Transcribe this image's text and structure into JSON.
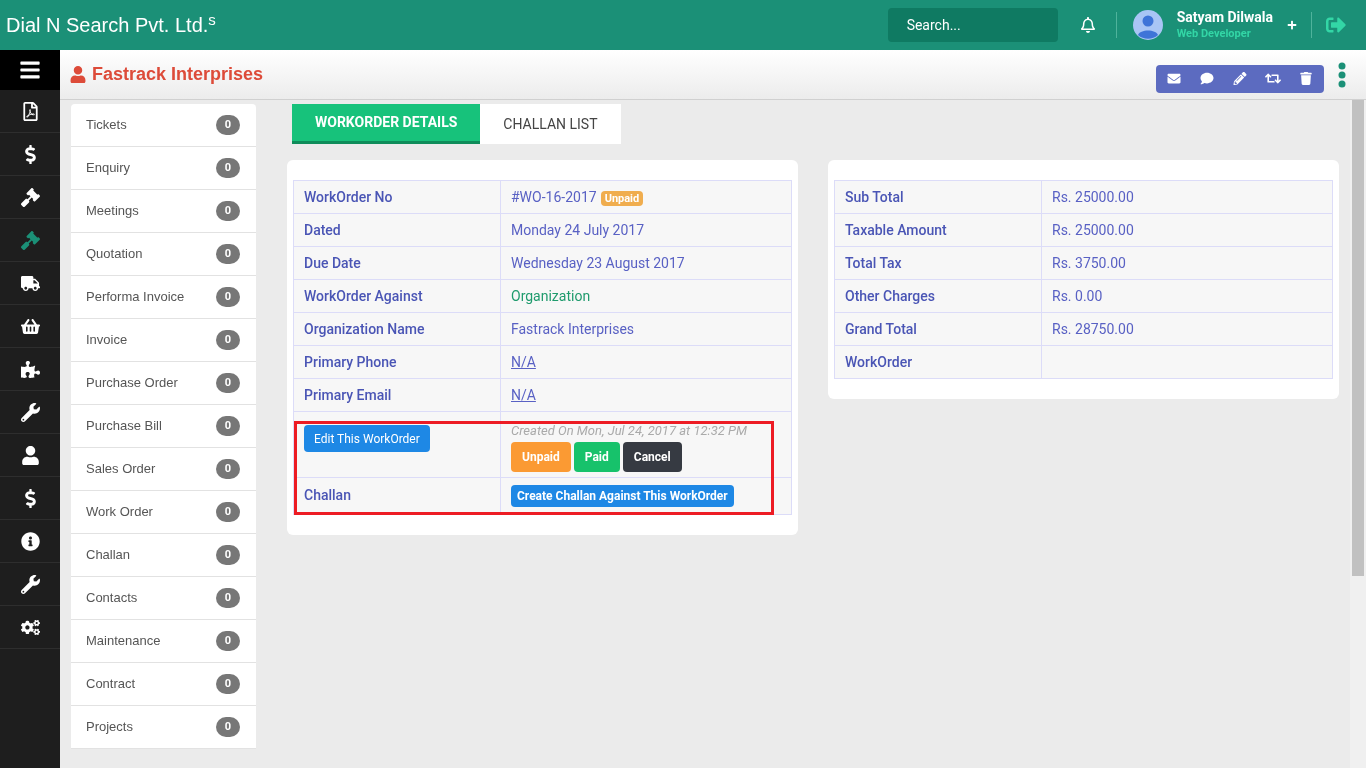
{
  "topbar": {
    "brand": "Dial N Search Pvt. Ltd.$^{s}$",
    "search": {
      "placeholder": "Search..."
    },
    "user": {
      "name": "Satyam Dilwala",
      "role": "Web Developer"
    }
  },
  "rail": [
    {
      "kind": "pdf",
      "selected": false
    },
    {
      "kind": "dollar",
      "selected": false
    },
    {
      "kind": "gavel",
      "selected": false
    },
    {
      "kind": "gavel",
      "selected": true
    },
    {
      "kind": "truck",
      "selected": false
    },
    {
      "kind": "basket",
      "selected": false
    },
    {
      "kind": "puzzle",
      "selected": false
    },
    {
      "kind": "wrench",
      "selected": false
    },
    {
      "kind": "user",
      "selected": false
    },
    {
      "kind": "dollar",
      "selected": false
    },
    {
      "kind": "info",
      "selected": false
    },
    {
      "kind": "wrench",
      "selected": false
    },
    {
      "kind": "cogs",
      "selected": false
    }
  ],
  "page_title": "Fastrack Interprises",
  "toolbar": [
    {
      "kind": "mail"
    },
    {
      "kind": "comment"
    },
    {
      "kind": "pencil"
    },
    {
      "kind": "retweet"
    },
    {
      "kind": "trash"
    }
  ],
  "menu": [
    {
      "label": "Tickets",
      "count": "0"
    },
    {
      "label": "Enquiry",
      "count": "0"
    },
    {
      "label": "Meetings",
      "count": "0"
    },
    {
      "label": "Quotation",
      "count": "0"
    },
    {
      "label": "Performa Invoice",
      "count": "0"
    },
    {
      "label": "Invoice",
      "count": "0"
    },
    {
      "label": "Purchase Order",
      "count": "0"
    },
    {
      "label": "Purchase Bill",
      "count": "0"
    },
    {
      "label": "Sales Order",
      "count": "0"
    },
    {
      "label": "Work Order",
      "count": "0"
    },
    {
      "label": "Challan",
      "count": "0"
    },
    {
      "label": "Contacts",
      "count": "0"
    },
    {
      "label": "Maintenance",
      "count": "0"
    },
    {
      "label": "Contract",
      "count": "0"
    },
    {
      "label": "Projects",
      "count": "0"
    }
  ],
  "tabs": [
    {
      "label": "WORKORDER DETAILS",
      "selected": true
    },
    {
      "label": "CHALLAN LIST",
      "selected": false
    }
  ],
  "details": [
    {
      "label": "WorkOrder No",
      "kind": "badge",
      "value": "#WO-16-2017",
      "badge": "Unpaid"
    },
    {
      "label": "Dated",
      "kind": "text",
      "value": "Monday 24 July 2017"
    },
    {
      "label": "Due Date",
      "kind": "text",
      "value": "Wednesday 23 August 2017"
    },
    {
      "label": "WorkOrder Against",
      "kind": "accent",
      "value": "Organization"
    },
    {
      "label": "Organization Name",
      "kind": "text",
      "value": "Fastrack Interprises"
    },
    {
      "label": "Primary Phone",
      "kind": "link",
      "value": "N/A"
    },
    {
      "label": "Primary Email",
      "kind": "link",
      "value": "N/A"
    }
  ],
  "actions": {
    "edit_button": "Edit This WorkOrder",
    "created": "Created On Mon, Jul 24, 2017 at 12:32 PM",
    "status_buttons": [
      {
        "label": "Unpaid",
        "kind": "unpaid"
      },
      {
        "label": "Paid",
        "kind": "paid"
      },
      {
        "label": "Cancel",
        "kind": "cancel"
      }
    ],
    "challan_label": "Challan",
    "challan_button": "Create Challan Against This WorkOrder"
  },
  "totals": [
    {
      "label": "Sub Total",
      "value": "Rs. 25000.00"
    },
    {
      "label": "Taxable Amount",
      "value": "Rs. 25000.00"
    },
    {
      "label": "Total Tax",
      "value": "Rs. 3750.00"
    },
    {
      "label": "Other Charges",
      "value": "Rs. 0.00"
    },
    {
      "label": "Grand Total",
      "value": "Rs. 28750.00"
    },
    {
      "label": "WorkOrder"
    }
  ]
}
